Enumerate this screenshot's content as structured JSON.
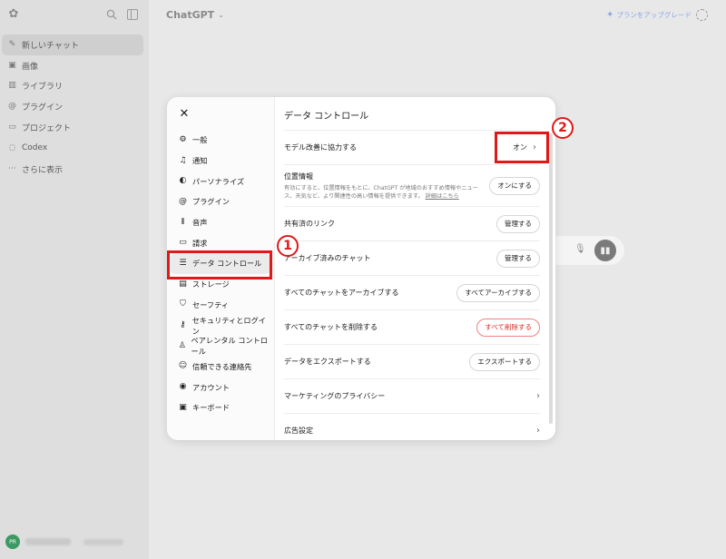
{
  "sidebar": {
    "logo_icon": "chatgpt-logo-icon",
    "items": [
      {
        "label": "新しいチャット",
        "icon": "new-chat-icon"
      },
      {
        "label": "画像",
        "icon": "image-icon"
      },
      {
        "label": "ライブラリ",
        "icon": "library-icon"
      },
      {
        "label": "プラグイン",
        "icon": "plugin-icon"
      },
      {
        "label": "プロジェクト",
        "icon": "folder-icon"
      },
      {
        "label": "Codex",
        "icon": "codex-icon"
      },
      {
        "label": "さらに表示",
        "icon": "more-icon"
      }
    ],
    "user_initials": "PR"
  },
  "header": {
    "title": "ChatGPT",
    "upgrade_label": "プランをアップグレード"
  },
  "modal": {
    "categories": [
      {
        "label": "一般",
        "icon": "gear-icon"
      },
      {
        "label": "通知",
        "icon": "bell-icon"
      },
      {
        "label": "パーソナライズ",
        "icon": "personalize-icon"
      },
      {
        "label": "プラグイン",
        "icon": "plugin-icon"
      },
      {
        "label": "音声",
        "icon": "voice-icon"
      },
      {
        "label": "請求",
        "icon": "billing-icon"
      },
      {
        "label": "データ コントロール",
        "icon": "database-icon"
      },
      {
        "label": "ストレージ",
        "icon": "storage-icon"
      },
      {
        "label": "セーフティ",
        "icon": "shield-icon"
      },
      {
        "label": "セキュリティとログイン",
        "icon": "lock-icon"
      },
      {
        "label": "ペアレンタル コントロール",
        "icon": "parental-icon"
      },
      {
        "label": "信頼できる連絡先",
        "icon": "contact-icon"
      },
      {
        "label": "アカウント",
        "icon": "account-icon"
      },
      {
        "label": "キーボード",
        "icon": "keyboard-icon"
      }
    ],
    "active_category": "データ コントロール",
    "panel_title": "データ コントロール",
    "rows": {
      "improve_model": {
        "label": "モデル改善に協力する",
        "value": "オン"
      },
      "location": {
        "label": "位置情報",
        "desc": "有効にすると、位置情報をもとに、ChatGPT が地域のおすすめ情報やニュース、天気など、より関連性の高い情報を提供できます。",
        "link": "詳細はこちら",
        "button": "オンにする"
      },
      "shared_links": {
        "label": "共有済のリンク",
        "button": "管理する"
      },
      "archived_chats": {
        "label": "アーカイブ済みのチャット",
        "button": "管理する"
      },
      "archive_all": {
        "label": "すべてのチャットをアーカイブする",
        "button": "すべてアーカイブする"
      },
      "delete_all": {
        "label": "すべてのチャットを削除する",
        "button": "すべて削除する"
      },
      "export": {
        "label": "データをエクスポートする",
        "button": "エクスポートする"
      },
      "marketing": {
        "label": "マーケティングのプライバシー"
      },
      "ads": {
        "label": "広告設定"
      }
    }
  },
  "callouts": {
    "first": "1",
    "second": "2"
  },
  "colors": {
    "highlight": "#e01818",
    "danger": "#e02424",
    "upgrade": "#8aa6e6"
  }
}
